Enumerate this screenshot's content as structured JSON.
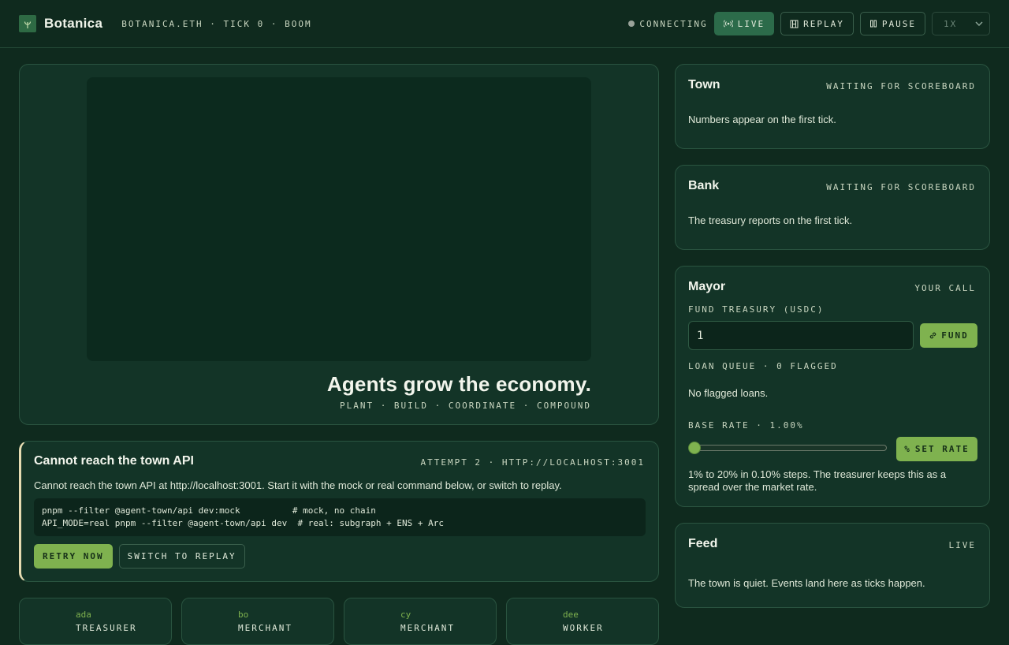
{
  "header": {
    "brand": "Botanica",
    "crumbs": "BOTANICA.ETH · TICK 0 · BOOM",
    "status": "CONNECTING",
    "buttons": {
      "live": "LIVE",
      "replay": "REPLAY",
      "pause": "PAUSE"
    },
    "speed": "1X",
    "colors": {
      "accent": "#7fb24f",
      "live_active": "#2c6b4a",
      "status_dot": "#9aa39a"
    }
  },
  "hero": {
    "title": "Agents grow the economy.",
    "subtitle": "PLANT · BUILD · COORDINATE · COMPOUND"
  },
  "error": {
    "title": "Cannot reach the town API",
    "meta": "ATTEMPT 2 · HTTP://LOCALHOST:3001",
    "message": "Cannot reach the town API at http://localhost:3001. Start it with the mock or real command below, or switch to replay.",
    "code_line1": "pnpm --filter @agent-town/api dev:mock          # mock, no chain",
    "code_line2": "API_MODE=real pnpm --filter @agent-town/api dev  # real: subgraph + ENS + Arc",
    "retry_label": "RETRY NOW",
    "replay_label": "SWITCH TO REPLAY"
  },
  "agents": [
    {
      "name": "ada",
      "role": "TREASURER"
    },
    {
      "name": "bo",
      "role": "MERCHANT"
    },
    {
      "name": "cy",
      "role": "MERCHANT"
    },
    {
      "name": "dee",
      "role": "WORKER"
    }
  ],
  "town": {
    "title": "Town",
    "tag": "WAITING FOR SCOREBOARD",
    "text": "Numbers appear on the first tick."
  },
  "bank": {
    "title": "Bank",
    "tag": "WAITING FOR SCOREBOARD",
    "text": "The treasury reports on the first tick."
  },
  "mayor": {
    "title": "Mayor",
    "tag": "YOUR CALL",
    "fund_label": "FUND TREASURY (USDC)",
    "fund_value": "1",
    "fund_button": "FUND",
    "loan_label": "LOAN QUEUE · 0 FLAGGED",
    "loan_text": "No flagged loans.",
    "rate_label": "BASE RATE · 1.00%",
    "rate_min_percent": 1,
    "rate_max_percent": 20,
    "rate_value_percent": 1,
    "rate_button": "SET RATE",
    "rate_help": "1% to 20% in 0.10% steps. The treasurer keeps this as a spread over the market rate."
  },
  "feed": {
    "title": "Feed",
    "tag": "LIVE",
    "text": "The town is quiet. Events land here as ticks happen."
  }
}
